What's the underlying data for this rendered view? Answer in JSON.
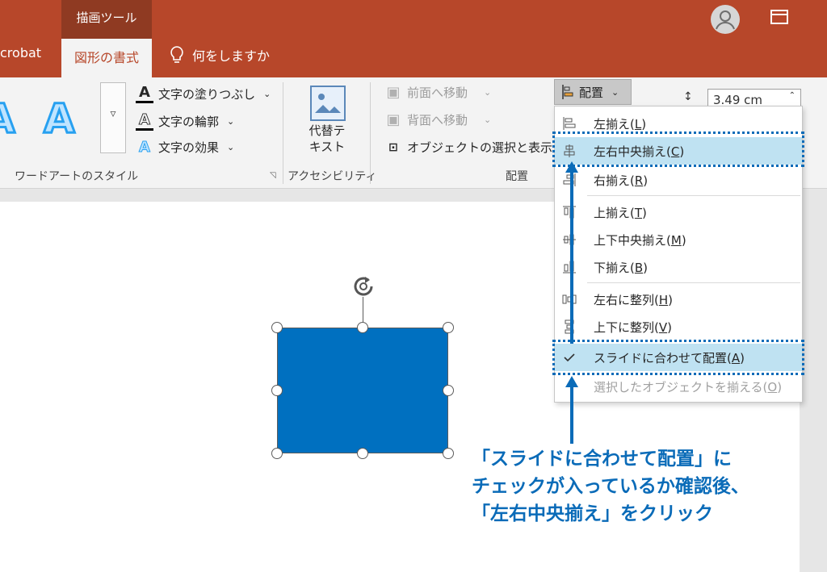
{
  "title_bar": {
    "context_tab": "描画ツール",
    "tabs": [
      "crobat",
      "図形の書式"
    ],
    "tell_me": "何をしますか"
  },
  "ribbon": {
    "wordart": {
      "letter": "A",
      "cmd_fill": "文字の塗りつぶし",
      "cmd_outline": "文字の輪郭",
      "cmd_effects": "文字の効果",
      "group_label": "ワードアートのスタイル"
    },
    "accessibility": {
      "alt_text_label": "代替テ\nキスト",
      "group_label": "アクセシビリティ"
    },
    "arrange": {
      "bring_forward": "前面へ移動",
      "send_backward": "背面へ移動",
      "selection_pane": "オブジェクトの選択と表示",
      "align_button": "配置",
      "group_label": "配置"
    },
    "size": {
      "height_value": "3.49 cm"
    }
  },
  "align_menu": {
    "items": [
      {
        "label": "左揃え(",
        "key": "L",
        "icon": "align-left-icon"
      },
      {
        "label": "左右中央揃え(",
        "key": "C",
        "icon": "align-center-icon"
      },
      {
        "label": "右揃え(",
        "key": "R",
        "icon": "align-right-icon"
      },
      {
        "label": "上揃え(",
        "key": "T",
        "icon": "align-top-icon"
      },
      {
        "label": "上下中央揃え(",
        "key": "M",
        "icon": "align-middle-icon"
      },
      {
        "label": "下揃え(",
        "key": "B",
        "icon": "align-bottom-icon"
      },
      {
        "label": "左右に整列(",
        "key": "H",
        "icon": "distribute-horizontal-icon"
      },
      {
        "label": "上下に整列(",
        "key": "V",
        "icon": "distribute-vertical-icon"
      },
      {
        "label": "スライドに合わせて配置(",
        "key": "A",
        "icon": "check-icon"
      },
      {
        "label": "選択したオブジェクトを揃える(",
        "key": "O",
        "icon": ""
      }
    ],
    "close_paren": ")"
  },
  "annotation": {
    "lines": [
      "「スライドに合わせて配置」に",
      "チェックが入っているか確認後、",
      "「左右中央揃え」をクリック"
    ],
    "color": "#0a6bb8"
  },
  "colors": {
    "title_bar": "#b7472a",
    "shape_fill": "#0070c0",
    "menu_highlight": "#bfe2f2"
  }
}
